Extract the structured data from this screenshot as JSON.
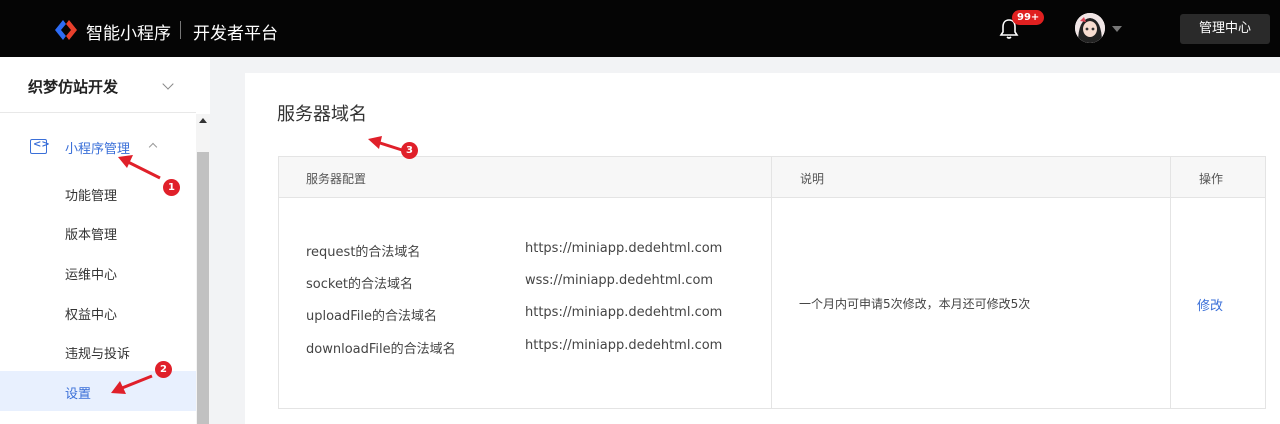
{
  "header": {
    "brand": "智能小程序",
    "platform": "开发者平台",
    "notification_badge": "99+",
    "manage_button": "管理中心"
  },
  "sidebar": {
    "app_name": "织梦仿站开发",
    "group_label": "小程序管理",
    "group_icon": "<>",
    "items": [
      {
        "label": "功能管理"
      },
      {
        "label": "版本管理"
      },
      {
        "label": "运维中心"
      },
      {
        "label": "权益中心"
      },
      {
        "label": "违规与投诉"
      },
      {
        "label": "设置",
        "active": true
      }
    ]
  },
  "main": {
    "title": "服务器域名",
    "table": {
      "headers": [
        "服务器配置",
        "说明",
        "操作"
      ],
      "config_rows": [
        {
          "label": "request的合法域名",
          "value": "https://miniapp.dedehtml.com"
        },
        {
          "label": "socket的合法域名",
          "value": "wss://miniapp.dedehtml.com"
        },
        {
          "label": "uploadFile的合法域名",
          "value": "https://miniapp.dedehtml.com"
        },
        {
          "label": "downloadFile的合法域名",
          "value": "https://miniapp.dedehtml.com"
        }
      ],
      "description": "一个月内可申请5次修改，本月还可修改5次",
      "action": "修改"
    }
  },
  "annotations": [
    "1",
    "2",
    "3"
  ],
  "colors": {
    "accent": "#3a6fd8",
    "topbar": "#050505",
    "annotation": "#e0202a"
  }
}
